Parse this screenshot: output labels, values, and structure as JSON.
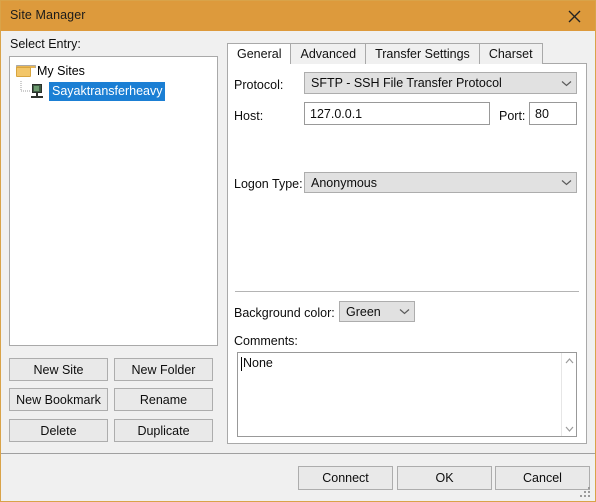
{
  "window": {
    "title": "Site Manager",
    "close_icon": "close-icon",
    "titlebar_color": "#dd9a3c"
  },
  "left_panel": {
    "label": "Select Entry:",
    "tree": {
      "root": {
        "label": "My Sites",
        "icon": "folder-icon"
      },
      "children": [
        {
          "label": "Sayaktransferheavy",
          "icon": "server-icon",
          "selected": true,
          "selection_color": "#1b7fd4"
        }
      ]
    },
    "buttons": {
      "new_site": "New Site",
      "new_folder": "New Folder",
      "new_bookmark": "New Bookmark",
      "rename": "Rename",
      "delete": "Delete",
      "duplicate": "Duplicate"
    }
  },
  "right_panel": {
    "tabs": [
      {
        "label": "General",
        "active": true
      },
      {
        "label": "Advanced",
        "active": false
      },
      {
        "label": "Transfer Settings",
        "active": false
      },
      {
        "label": "Charset",
        "active": false
      }
    ],
    "general": {
      "protocol_label": "Protocol:",
      "protocol_value": "SFTP - SSH File Transfer Protocol",
      "host_label": "Host:",
      "host_value": "127.0.0.1",
      "port_label": "Port:",
      "port_value": "80",
      "logon_type_label": "Logon Type:",
      "logon_type_value": "Anonymous",
      "background_color_label": "Background color:",
      "background_color_value": "Green",
      "comments_label": "Comments:",
      "comments_value": "None"
    }
  },
  "footer": {
    "connect": "Connect",
    "ok": "OK",
    "cancel": "Cancel",
    "resize_grip": "resize-grip"
  }
}
